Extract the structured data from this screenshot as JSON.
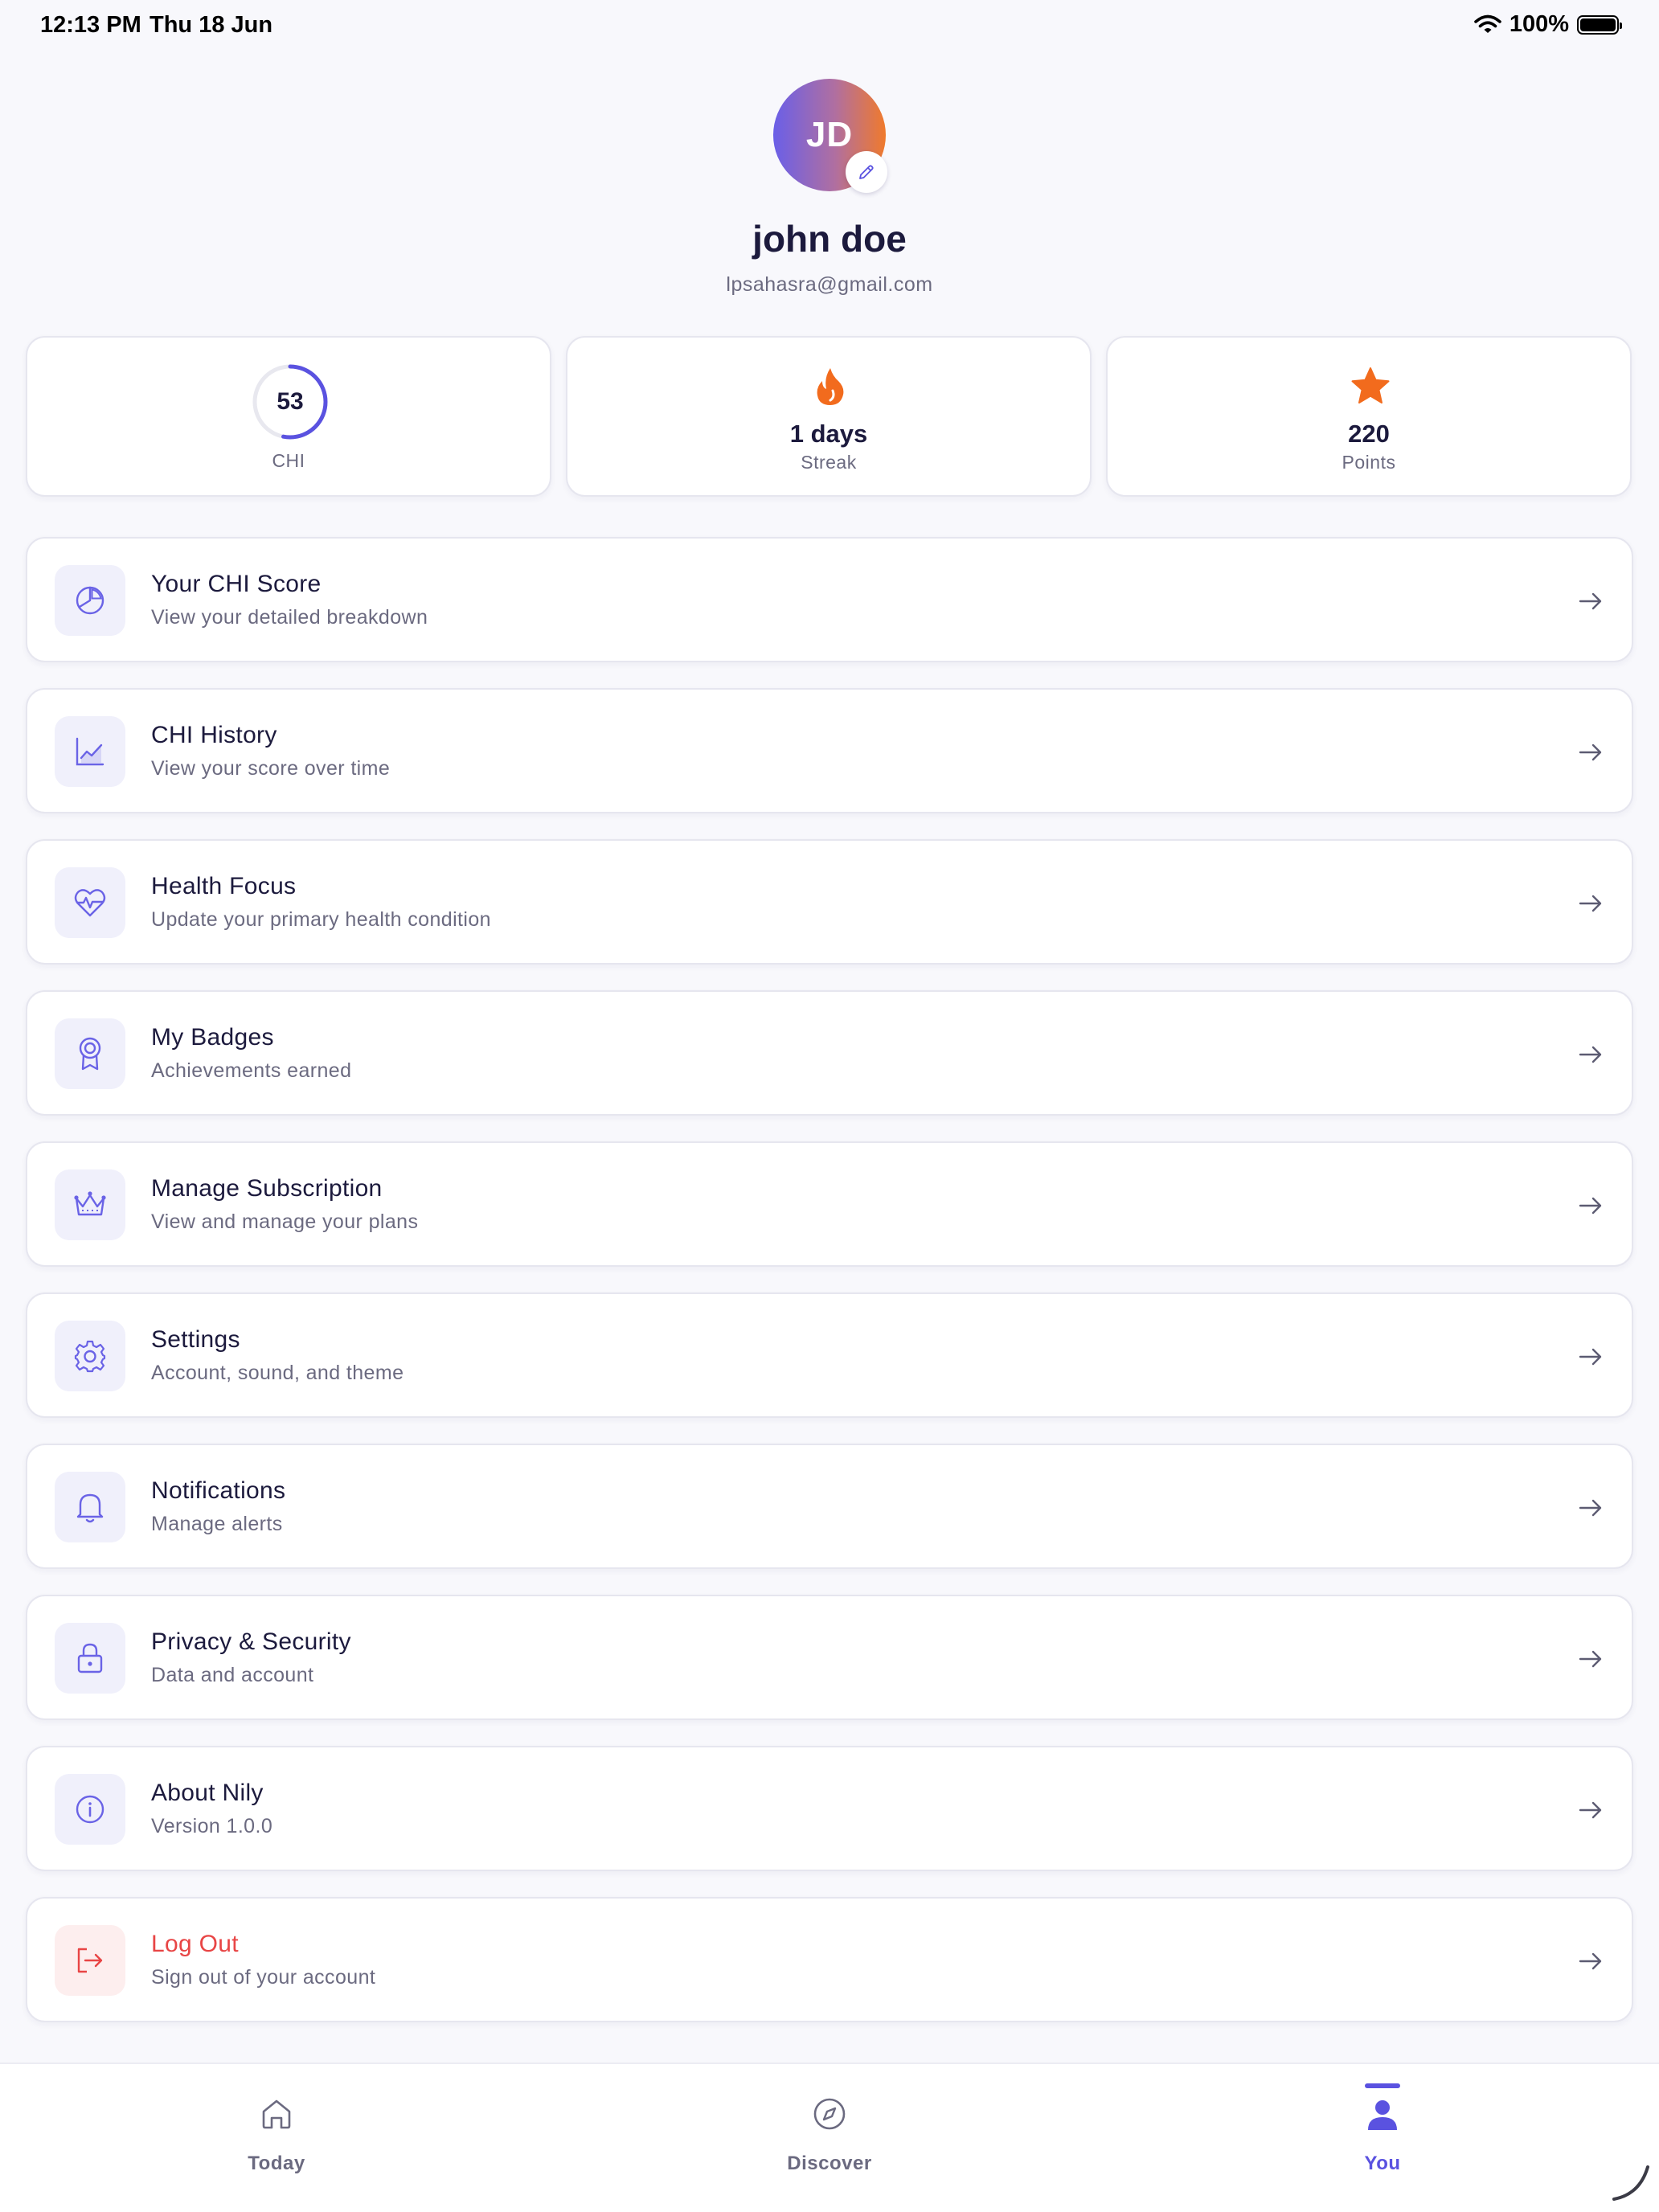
{
  "status_bar": {
    "time": "12:13 PM",
    "date": "Thu 18 Jun",
    "battery": "100%"
  },
  "profile": {
    "initials": "JD",
    "name": "john doe",
    "email": "lpsahasra@gmail.com"
  },
  "stats": {
    "chi": {
      "value": "53",
      "label": "CHI",
      "progress_fraction": 0.53
    },
    "streak": {
      "value": "1 days",
      "label": "Streak"
    },
    "points": {
      "value": "220",
      "label": "Points"
    }
  },
  "menu": [
    {
      "title": "Your CHI Score",
      "subtitle": "View your detailed breakdown",
      "icon": "pie-chart-icon"
    },
    {
      "title": "CHI History",
      "subtitle": "View your score over time",
      "icon": "line-chart-icon"
    },
    {
      "title": "Health Focus",
      "subtitle": "Update your primary health condition",
      "icon": "heart-pulse-icon"
    },
    {
      "title": "My Badges",
      "subtitle": "Achievements earned",
      "icon": "badge-icon"
    },
    {
      "title": "Manage Subscription",
      "subtitle": "View and manage your plans",
      "icon": "crown-icon"
    },
    {
      "title": "Settings",
      "subtitle": "Account, sound, and theme",
      "icon": "gear-icon"
    },
    {
      "title": "Notifications",
      "subtitle": "Manage alerts",
      "icon": "bell-icon"
    },
    {
      "title": "Privacy & Security",
      "subtitle": "Data and account",
      "icon": "lock-icon"
    },
    {
      "title": "About Nily",
      "subtitle": "Version 1.0.0",
      "icon": "info-icon"
    },
    {
      "title": "Log Out",
      "subtitle": "Sign out of your account",
      "icon": "logout-icon"
    }
  ],
  "bottom_nav": {
    "today": "Today",
    "discover": "Discover",
    "you": "You"
  },
  "colors": {
    "accent": "#5a52e0",
    "streak_orange": "#f26b1d",
    "danger": "#e84545",
    "background": "#f8f8fc"
  }
}
